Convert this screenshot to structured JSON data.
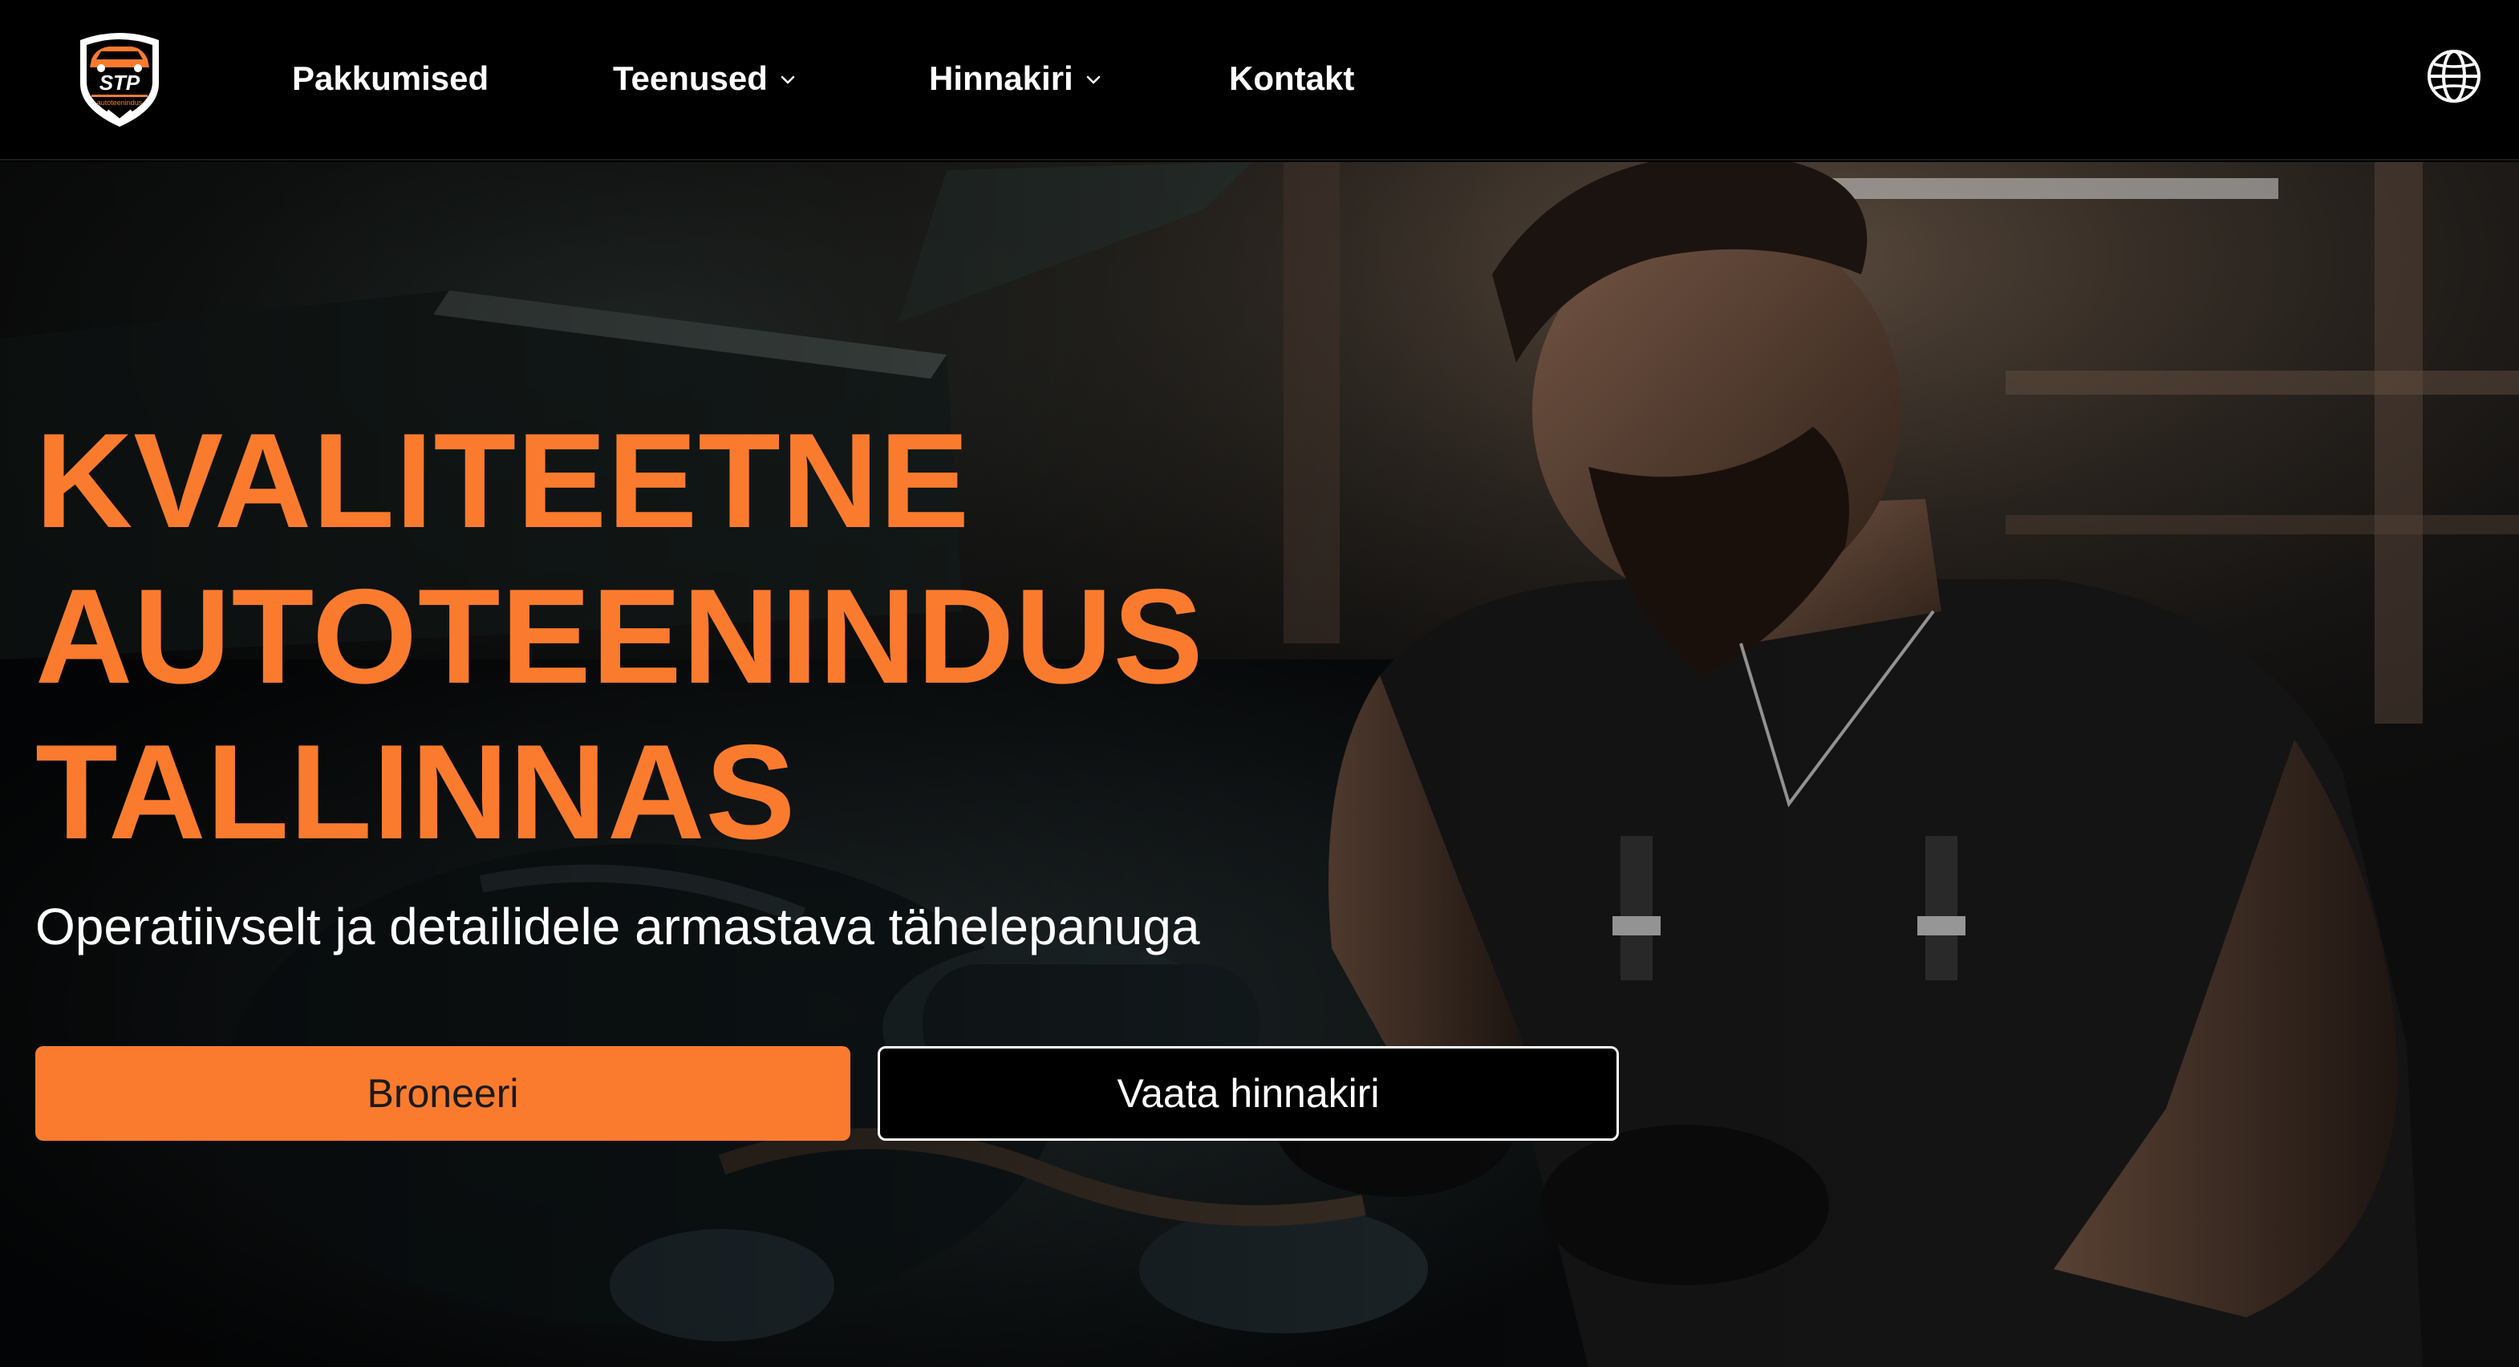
{
  "nav": {
    "logo": {
      "brand": "STP",
      "tagline": "autoteenindus",
      "accent": "#fa7b2e"
    },
    "items": [
      {
        "label": "Pakkumised",
        "has_dropdown": false
      },
      {
        "label": "Teenused",
        "has_dropdown": true
      },
      {
        "label": "Hinnakiri",
        "has_dropdown": true
      },
      {
        "label": "Kontakt",
        "has_dropdown": false
      }
    ],
    "language_icon": "globe-icon"
  },
  "hero": {
    "headline_lines": [
      "KVALITEETNE",
      "AUTOTEENINDUS",
      "TALLINNAS"
    ],
    "subheadline": "Operatiivselt ja detailidele armastava tähelepanuga",
    "primary_button": "Broneeri",
    "secondary_button": "Vaata hinnakiri",
    "background_image": "mechanic working on car engine in dark garage"
  },
  "colors": {
    "accent": "#fa7b2e",
    "nav_background": "#000000",
    "text": "#ffffff"
  }
}
